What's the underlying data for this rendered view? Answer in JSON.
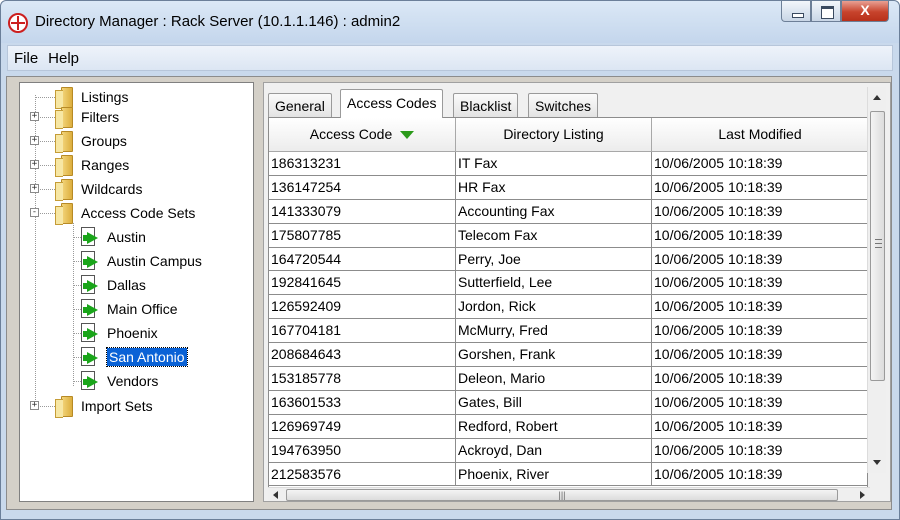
{
  "window": {
    "title": "Directory Manager : Rack Server (10.1.1.146) : admin2",
    "close_glyph": "X"
  },
  "menu": {
    "file": "File",
    "help": "Help"
  },
  "tree": {
    "items": [
      {
        "label": "Listings"
      },
      {
        "label": "Filters"
      },
      {
        "label": "Groups"
      },
      {
        "label": "Ranges"
      },
      {
        "label": "Wildcards"
      },
      {
        "label": "Access Code Sets"
      },
      {
        "label": "Austin"
      },
      {
        "label": "Austin Campus"
      },
      {
        "label": "Dallas"
      },
      {
        "label": "Main Office"
      },
      {
        "label": "Phoenix"
      },
      {
        "label": "San Antonio",
        "selected": true
      },
      {
        "label": "Vendors"
      },
      {
        "label": "Import Sets"
      }
    ]
  },
  "tabs": [
    "General",
    "Access Codes",
    "Blacklist",
    "Switches"
  ],
  "active_tab": "Access Codes",
  "table": {
    "headers": [
      "Access Code",
      "Directory Listing",
      "Last Modified"
    ],
    "sort_column": "Access Code",
    "sort_direction": "descending",
    "rows": [
      [
        "186313231",
        "IT Fax",
        "10/06/2005 10:18:39"
      ],
      [
        "136147254",
        "HR Fax",
        "10/06/2005 10:18:39"
      ],
      [
        "141333079",
        "Accounting Fax",
        "10/06/2005 10:18:39"
      ],
      [
        "175807785",
        "Telecom Fax",
        "10/06/2005 10:18:39"
      ],
      [
        "164720544",
        "Perry, Joe",
        "10/06/2005 10:18:39"
      ],
      [
        "192841645",
        "Sutterfield, Lee",
        "10/06/2005 10:18:39"
      ],
      [
        "126592409",
        "Jordon, Rick",
        "10/06/2005 10:18:39"
      ],
      [
        "167704181",
        "McMurry, Fred",
        "10/06/2005 10:18:39"
      ],
      [
        "208684643",
        "Gorshen, Frank",
        "10/06/2005 10:18:39"
      ],
      [
        "153185778",
        "Deleon, Mario",
        "10/06/2005 10:18:39"
      ],
      [
        "163601533",
        "Gates, Bill",
        "10/06/2005 10:18:39"
      ],
      [
        "126969749",
        "Redford, Robert",
        "10/06/2005 10:18:39"
      ],
      [
        "194763950",
        "Ackroyd, Dan",
        "10/06/2005 10:18:39"
      ],
      [
        "212583576",
        "Phoenix, River",
        "10/06/2005 10:18:39"
      ]
    ]
  },
  "colors": {
    "selection": "#0a62d6",
    "sort_arrow": "#2b9a1a",
    "titlebar": "#c4d6ec"
  }
}
